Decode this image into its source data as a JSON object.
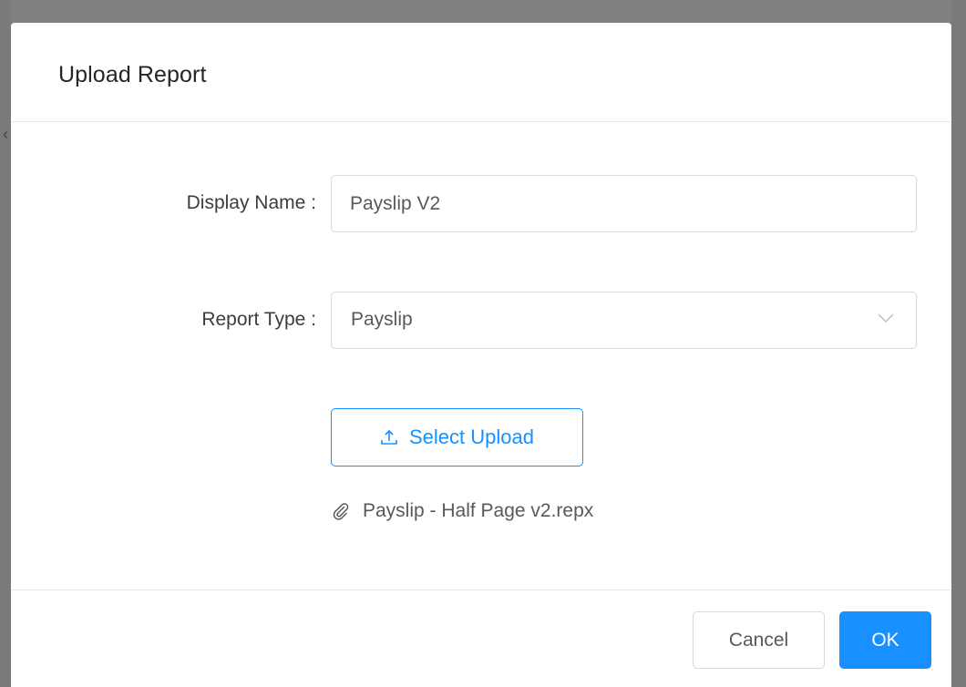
{
  "dialog": {
    "title": "Upload Report"
  },
  "form": {
    "display_name_label": "Display Name :",
    "display_name_value": "Payslip V2",
    "report_type_label": "Report Type :",
    "report_type_value": "Payslip"
  },
  "upload": {
    "button_label": "Select Upload",
    "file_name": "Payslip - Half Page v2.repx"
  },
  "footer": {
    "cancel_label": "Cancel",
    "ok_label": "OK"
  },
  "colors": {
    "accent": "#1890ff",
    "border": "#d9d9d9",
    "text": "#595959",
    "overlay": "#808080"
  },
  "icons": {
    "dropdown": "chevron-down-icon",
    "upload": "upload-icon",
    "attachment": "paperclip-icon"
  }
}
